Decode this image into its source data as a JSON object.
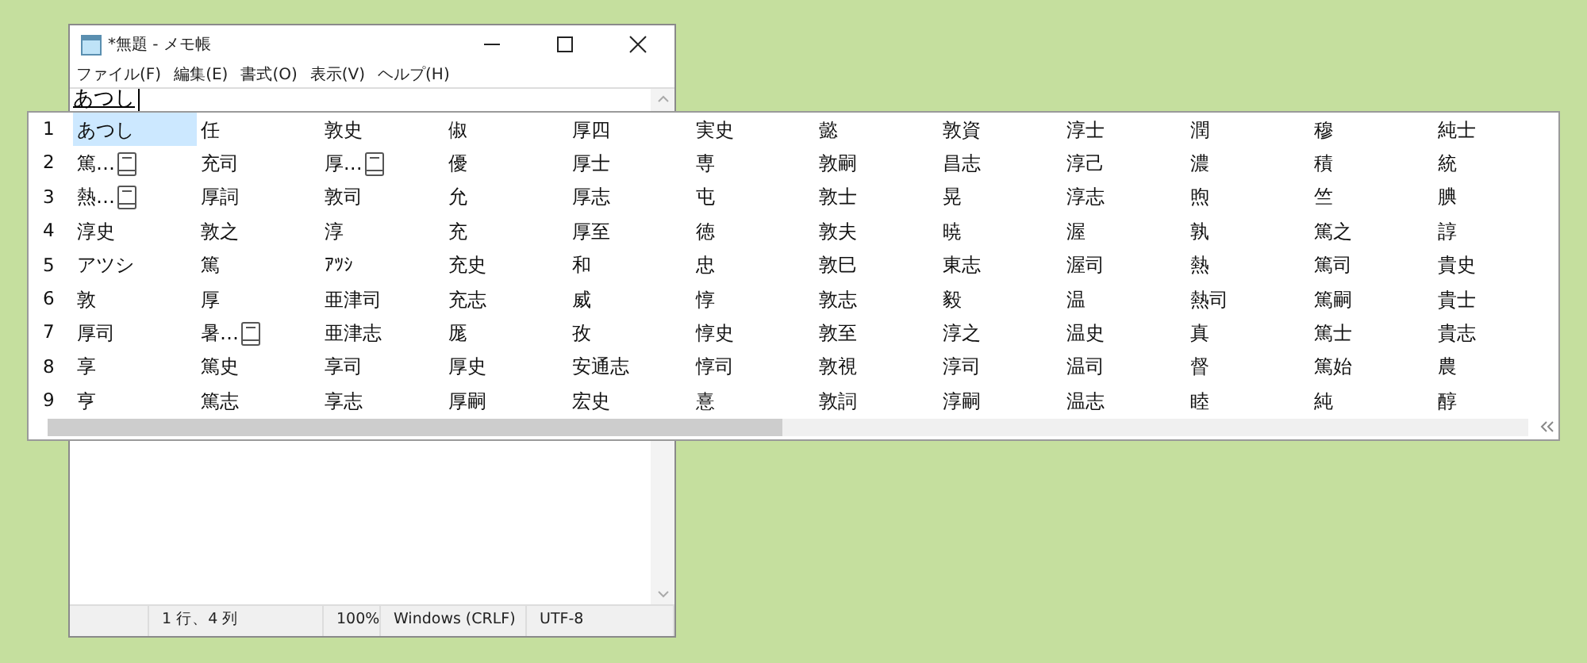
{
  "window": {
    "title": "*無題 - メモ帳"
  },
  "menu": [
    "ファイル(F)",
    "編集(E)",
    "書式(O)",
    "表示(V)",
    "ヘルプ(H)"
  ],
  "editor": {
    "value": "あつし"
  },
  "candidates": [
    {
      "number": "1",
      "cells": [
        {
          "text": "あつし",
          "selected": true,
          "note": false
        },
        {
          "text": "任",
          "selected": false,
          "note": false
        },
        {
          "text": "敦史",
          "selected": false,
          "note": false
        },
        {
          "text": "俶",
          "selected": false,
          "note": false
        },
        {
          "text": "厚四",
          "selected": false,
          "note": false
        },
        {
          "text": "実史",
          "selected": false,
          "note": false
        },
        {
          "text": "懿",
          "selected": false,
          "note": false
        },
        {
          "text": "敦資",
          "selected": false,
          "note": false
        },
        {
          "text": "淳士",
          "selected": false,
          "note": false
        },
        {
          "text": "潤",
          "selected": false,
          "note": false
        },
        {
          "text": "穆",
          "selected": false,
          "note": false
        },
        {
          "text": "純士",
          "selected": false,
          "note": false
        }
      ]
    },
    {
      "number": "2",
      "cells": [
        {
          "text": "篤…",
          "selected": false,
          "note": true
        },
        {
          "text": "充司",
          "selected": false,
          "note": false
        },
        {
          "text": "厚…",
          "selected": false,
          "note": true
        },
        {
          "text": "優",
          "selected": false,
          "note": false
        },
        {
          "text": "厚士",
          "selected": false,
          "note": false
        },
        {
          "text": "専",
          "selected": false,
          "note": false
        },
        {
          "text": "敦嗣",
          "selected": false,
          "note": false
        },
        {
          "text": "昌志",
          "selected": false,
          "note": false
        },
        {
          "text": "淳己",
          "selected": false,
          "note": false
        },
        {
          "text": "濃",
          "selected": false,
          "note": false
        },
        {
          "text": "積",
          "selected": false,
          "note": false
        },
        {
          "text": "統",
          "selected": false,
          "note": false
        }
      ]
    },
    {
      "number": "3",
      "cells": [
        {
          "text": "熱…",
          "selected": false,
          "note": true
        },
        {
          "text": "厚詞",
          "selected": false,
          "note": false
        },
        {
          "text": "敦司",
          "selected": false,
          "note": false
        },
        {
          "text": "允",
          "selected": false,
          "note": false
        },
        {
          "text": "厚志",
          "selected": false,
          "note": false
        },
        {
          "text": "屯",
          "selected": false,
          "note": false
        },
        {
          "text": "敦士",
          "selected": false,
          "note": false
        },
        {
          "text": "晃",
          "selected": false,
          "note": false
        },
        {
          "text": "淳志",
          "selected": false,
          "note": false
        },
        {
          "text": "煦",
          "selected": false,
          "note": false
        },
        {
          "text": "竺",
          "selected": false,
          "note": false
        },
        {
          "text": "腆",
          "selected": false,
          "note": false
        }
      ]
    },
    {
      "number": "4",
      "cells": [
        {
          "text": "淳史",
          "selected": false,
          "note": false
        },
        {
          "text": "敦之",
          "selected": false,
          "note": false
        },
        {
          "text": "淳",
          "selected": false,
          "note": false
        },
        {
          "text": "充",
          "selected": false,
          "note": false
        },
        {
          "text": "厚至",
          "selected": false,
          "note": false
        },
        {
          "text": "徳",
          "selected": false,
          "note": false
        },
        {
          "text": "敦夫",
          "selected": false,
          "note": false
        },
        {
          "text": "暁",
          "selected": false,
          "note": false
        },
        {
          "text": "渥",
          "selected": false,
          "note": false
        },
        {
          "text": "孰",
          "selected": false,
          "note": false
        },
        {
          "text": "篤之",
          "selected": false,
          "note": false
        },
        {
          "text": "諄",
          "selected": false,
          "note": false
        }
      ]
    },
    {
      "number": "5",
      "cells": [
        {
          "text": "アツシ",
          "selected": false,
          "note": false
        },
        {
          "text": "篤",
          "selected": false,
          "note": false
        },
        {
          "text": "ｱﾂｼ",
          "selected": false,
          "note": false
        },
        {
          "text": "充史",
          "selected": false,
          "note": false
        },
        {
          "text": "和",
          "selected": false,
          "note": false
        },
        {
          "text": "忠",
          "selected": false,
          "note": false
        },
        {
          "text": "敦巳",
          "selected": false,
          "note": false
        },
        {
          "text": "東志",
          "selected": false,
          "note": false
        },
        {
          "text": "渥司",
          "selected": false,
          "note": false
        },
        {
          "text": "熱",
          "selected": false,
          "note": false
        },
        {
          "text": "篤司",
          "selected": false,
          "note": false
        },
        {
          "text": "貴史",
          "selected": false,
          "note": false
        }
      ]
    },
    {
      "number": "6",
      "cells": [
        {
          "text": "敦",
          "selected": false,
          "note": false
        },
        {
          "text": "厚",
          "selected": false,
          "note": false
        },
        {
          "text": "亜津司",
          "selected": false,
          "note": false
        },
        {
          "text": "充志",
          "selected": false,
          "note": false
        },
        {
          "text": "威",
          "selected": false,
          "note": false
        },
        {
          "text": "惇",
          "selected": false,
          "note": false
        },
        {
          "text": "敦志",
          "selected": false,
          "note": false
        },
        {
          "text": "毅",
          "selected": false,
          "note": false
        },
        {
          "text": "温",
          "selected": false,
          "note": false
        },
        {
          "text": "熱司",
          "selected": false,
          "note": false
        },
        {
          "text": "篤嗣",
          "selected": false,
          "note": false
        },
        {
          "text": "貴士",
          "selected": false,
          "note": false
        }
      ]
    },
    {
      "number": "7",
      "cells": [
        {
          "text": "厚司",
          "selected": false,
          "note": false
        },
        {
          "text": "暑…",
          "selected": false,
          "note": true
        },
        {
          "text": "亜津志",
          "selected": false,
          "note": false
        },
        {
          "text": "厖",
          "selected": false,
          "note": false
        },
        {
          "text": "孜",
          "selected": false,
          "note": false
        },
        {
          "text": "惇史",
          "selected": false,
          "note": false
        },
        {
          "text": "敦至",
          "selected": false,
          "note": false
        },
        {
          "text": "淳之",
          "selected": false,
          "note": false
        },
        {
          "text": "温史",
          "selected": false,
          "note": false
        },
        {
          "text": "真",
          "selected": false,
          "note": false
        },
        {
          "text": "篤士",
          "selected": false,
          "note": false
        },
        {
          "text": "貴志",
          "selected": false,
          "note": false
        }
      ]
    },
    {
      "number": "8",
      "cells": [
        {
          "text": "享",
          "selected": false,
          "note": false
        },
        {
          "text": "篤史",
          "selected": false,
          "note": false
        },
        {
          "text": "享司",
          "selected": false,
          "note": false
        },
        {
          "text": "厚史",
          "selected": false,
          "note": false
        },
        {
          "text": "安通志",
          "selected": false,
          "note": false
        },
        {
          "text": "惇司",
          "selected": false,
          "note": false
        },
        {
          "text": "敦視",
          "selected": false,
          "note": false
        },
        {
          "text": "淳司",
          "selected": false,
          "note": false
        },
        {
          "text": "温司",
          "selected": false,
          "note": false
        },
        {
          "text": "督",
          "selected": false,
          "note": false
        },
        {
          "text": "篤始",
          "selected": false,
          "note": false
        },
        {
          "text": "農",
          "selected": false,
          "note": false
        }
      ]
    },
    {
      "number": "9",
      "cells": [
        {
          "text": "亨",
          "selected": false,
          "note": false
        },
        {
          "text": "篤志",
          "selected": false,
          "note": false
        },
        {
          "text": "享志",
          "selected": false,
          "note": false
        },
        {
          "text": "厚嗣",
          "selected": false,
          "note": false
        },
        {
          "text": "宏史",
          "selected": false,
          "note": false
        },
        {
          "text": "憙",
          "selected": false,
          "note": false
        },
        {
          "text": "敦詞",
          "selected": false,
          "note": false
        },
        {
          "text": "淳嗣",
          "selected": false,
          "note": false
        },
        {
          "text": "温志",
          "selected": false,
          "note": false
        },
        {
          "text": "睦",
          "selected": false,
          "note": false
        },
        {
          "text": "純",
          "selected": false,
          "note": false
        },
        {
          "text": "醇",
          "selected": false,
          "note": false
        }
      ]
    }
  ],
  "status_bar": [
    "1 行、4 列",
    "100%",
    "Windows (CRLF)",
    "UTF-8"
  ]
}
